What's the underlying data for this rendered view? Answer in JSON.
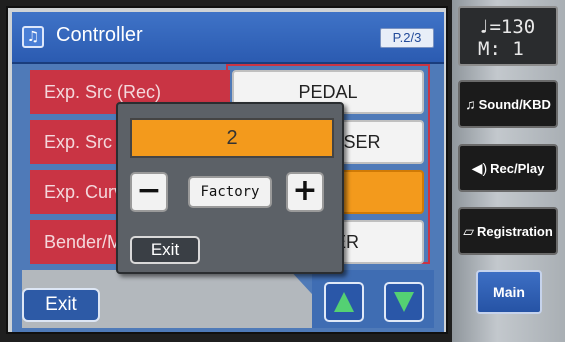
{
  "window": {
    "title": "Controller",
    "page_indicator": "P.2/3",
    "icon": "music-notes-icon"
  },
  "parameters": [
    {
      "label": "Exp. Src (Rec)",
      "value": "PEDAL"
    },
    {
      "label": "Exp. Src (Play)",
      "value": "COMPOSER"
    },
    {
      "label": "Exp. Curve",
      "value": "2"
    },
    {
      "label": "Bender/Modulation",
      "value": "UPPER"
    }
  ],
  "popup": {
    "value": "2",
    "minus_label": "−",
    "factory_label": "Factory",
    "plus_label": "+",
    "exit_label": "Exit"
  },
  "footer": {
    "exit_label": "Exit",
    "up_icon": "arrow-up-icon",
    "down_icon": "arrow-down-icon"
  },
  "sidebar": {
    "tempo": "♩=130",
    "measure": "M:   1",
    "buttons": [
      {
        "label": "Sound/KBD",
        "icon": "music-note-icon"
      },
      {
        "label": "Rec/Play",
        "icon": "speaker-icon"
      },
      {
        "label": "Registration",
        "icon": "book-icon"
      },
      {
        "label": "Main",
        "icon": ""
      }
    ]
  },
  "colors": {
    "accent_orange": "#f39a1c",
    "label_red": "#c93444",
    "title_blue": "#2b5bb1",
    "arrow_green": "#54d173"
  }
}
